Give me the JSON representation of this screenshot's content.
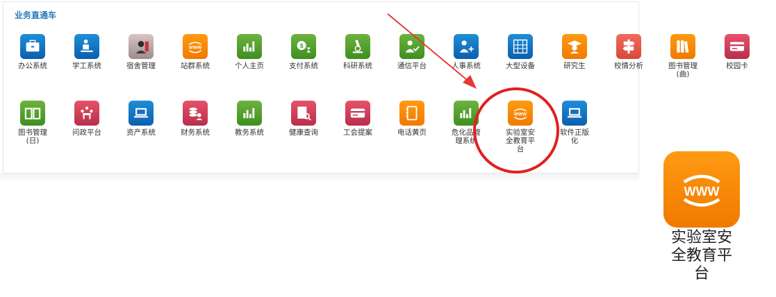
{
  "section": {
    "title": "业务直通车"
  },
  "apps_row1": [
    {
      "label": "办公系统",
      "icon": "briefcase-icon",
      "color": "blue"
    },
    {
      "label": "学工系统",
      "icon": "student-desk-icon",
      "color": "blue"
    },
    {
      "label": "宿舍管理",
      "icon": "person-photo-icon",
      "color": "photo"
    },
    {
      "label": "站群系统",
      "icon": "www-icon",
      "color": "orange"
    },
    {
      "label": "个人主页",
      "icon": "bar-chart-icon",
      "color": "green"
    },
    {
      "label": "支付系统",
      "icon": "dollar-hourglass-icon",
      "color": "green"
    },
    {
      "label": "科研系统",
      "icon": "microscope-icon",
      "color": "green"
    },
    {
      "label": "通信平台",
      "icon": "person-check-icon",
      "color": "green"
    },
    {
      "label": "人事系统",
      "icon": "person-plus-icon",
      "color": "blue"
    },
    {
      "label": "大型设备",
      "icon": "abacus-icon",
      "color": "blue"
    },
    {
      "label": "研究生",
      "icon": "graduate-icon",
      "color": "orange"
    },
    {
      "label": "校情分析",
      "icon": "signpost-icon",
      "color": "coral"
    },
    {
      "label": "图书管理\n(曲)",
      "icon": "books-icon",
      "color": "orange"
    },
    {
      "label": "校园卡",
      "icon": "card-icon",
      "color": "red"
    }
  ],
  "apps_row2": [
    {
      "label": "图书管理\n(日)",
      "icon": "open-book-icon",
      "color": "green"
    },
    {
      "label": "问政平台",
      "icon": "meeting-icon",
      "color": "red"
    },
    {
      "label": "资产系统",
      "icon": "laptop-icon",
      "color": "blue"
    },
    {
      "label": "财务系统",
      "icon": "coins-person-icon",
      "color": "red"
    },
    {
      "label": "教务系统",
      "icon": "bar-chart-icon",
      "color": "green"
    },
    {
      "label": "健康查询",
      "icon": "doc-search-icon",
      "color": "red"
    },
    {
      "label": "工会提案",
      "icon": "card-icon",
      "color": "red"
    },
    {
      "label": "电话黄页",
      "icon": "notebook-icon",
      "color": "orange"
    },
    {
      "label": "危化品管\n理系统",
      "icon": "bar-chart-icon",
      "color": "green"
    },
    {
      "label": "实验室安\n全教育平\n台",
      "icon": "www-icon",
      "color": "orange"
    },
    {
      "label": "软件正版\n化",
      "icon": "laptop-icon",
      "color": "blue"
    }
  ],
  "zoom": {
    "label": "实验室安\n全教育平\n台",
    "icon": "www-icon"
  },
  "colors": {
    "arrow": "#e53935",
    "circle": "#e02020",
    "title": "#2b7bb9"
  }
}
